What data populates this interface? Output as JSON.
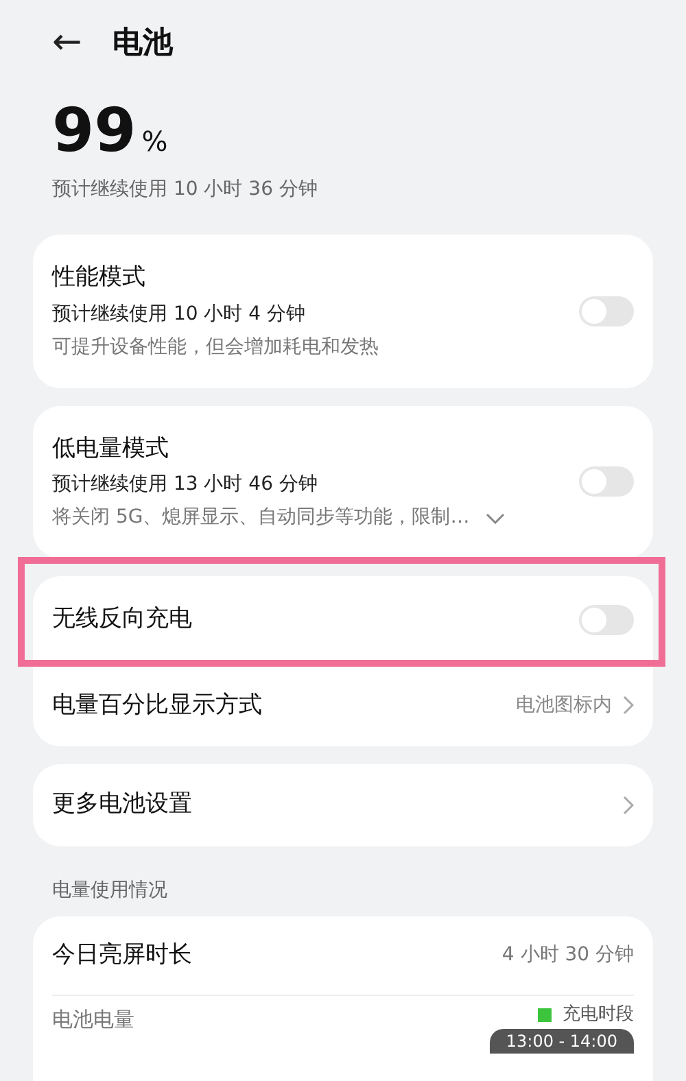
{
  "header": {
    "back": "←",
    "title": "电池"
  },
  "battery": {
    "percent": "99",
    "unit": "%",
    "estimate": "预计继续使用 10 小时 36 分钟"
  },
  "cards": [
    {
      "rows": [
        {
          "kind": "toggle",
          "title": "性能模式",
          "detail": "预计继续使用 10 小时 4 分钟",
          "note": "可提升设备性能，但会增加耗电和发热",
          "on": false,
          "expandable": false,
          "highlighted": false
        }
      ]
    },
    {
      "rows": [
        {
          "kind": "toggle",
          "title": "低电量模式",
          "detail": "预计继续使用 13 小时 46 分钟",
          "note": "将关闭 5G、熄屏显示、自动同步等功能，限制…",
          "on": false,
          "expandable": true,
          "highlighted": false
        }
      ]
    },
    {
      "rows": [
        {
          "kind": "toggle",
          "title": "无线反向充电",
          "on": false,
          "highlighted": true
        },
        {
          "kind": "link",
          "title": "电量百分比显示方式",
          "value": "电池图标内",
          "highlighted": false
        }
      ]
    },
    {
      "rows": [
        {
          "kind": "link",
          "title": "更多电池设置",
          "highlighted": false
        }
      ]
    }
  ],
  "usage": {
    "heading": "电量使用情况",
    "screen_time": {
      "title": "今日亮屏时长",
      "value": "4 小时 30 分钟"
    },
    "battery_level": {
      "title": "电池电量",
      "legend": {
        "label": "充电时段",
        "color": "#3cc43c"
      }
    },
    "tooltip": "13:00 - 14:00"
  }
}
